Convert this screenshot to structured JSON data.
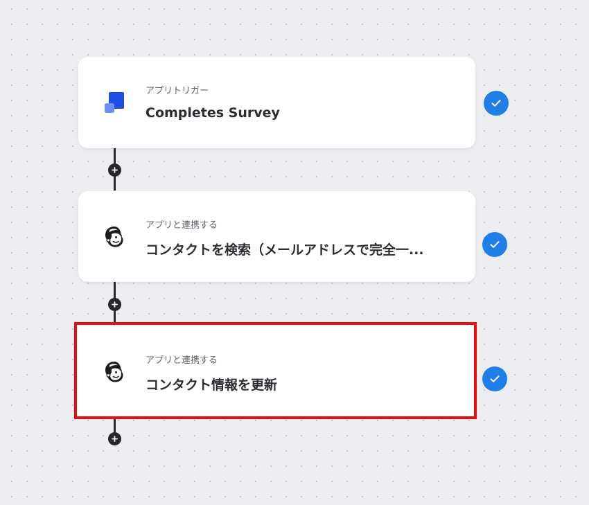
{
  "colors": {
    "canvas": "#eceef2",
    "connector": "#25272c",
    "check": "#1f7ee8",
    "selection": "#ec0d0d",
    "trigger_icon": "#1b4fe6"
  },
  "flow": {
    "steps": [
      {
        "label": "アプリトリガー",
        "title": "Completes Survey",
        "icon": "app-trigger-icon",
        "status": "completed"
      },
      {
        "label": "アプリと連携する",
        "title": "コンタクトを検索（メールアドレスで完全一...",
        "icon": "mailchimp-icon",
        "status": "completed"
      },
      {
        "label": "アプリと連携する",
        "title": "コンタクト情報を更新",
        "icon": "mailchimp-icon",
        "status": "completed",
        "selected": true
      }
    ]
  }
}
